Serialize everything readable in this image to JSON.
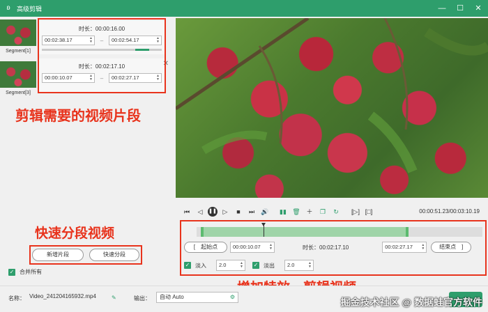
{
  "window": {
    "title": "高级剪辑",
    "app_icon": "frog-icon",
    "minimize": "—",
    "maximize": "☐",
    "close": "✕"
  },
  "thumbnails": [
    {
      "label": "Segment[1]"
    },
    {
      "label": "Segment[3]"
    }
  ],
  "segments": [
    {
      "duration": "时长：00:00:16.00",
      "start": "00:02:38.17",
      "end": "00:02:54.17"
    },
    {
      "duration": "时长：00:02:17.10",
      "start": "00:00:10.07",
      "end": "00:02:27.17"
    }
  ],
  "annotations": {
    "segments_note": "剪辑需要的视频片段",
    "split_note": "快速分段视频",
    "effects_note": "增加特效、剪辑视频"
  },
  "buttons": {
    "add_segment": "新增片段",
    "quick_split": "快速分段"
  },
  "merge_all": {
    "label": "合并所有",
    "checked": true
  },
  "player": {
    "time_readout": "00:00:51.23/00:03:10.19",
    "controls": [
      "step-back-icon",
      "prev-icon",
      "play-pause-icon",
      "next-icon",
      "stop-icon",
      "skip-end-icon",
      "volume-icon",
      "split-icon",
      "delete-icon",
      "add-icon",
      "copy-icon",
      "refresh-icon",
      "mark-in-icon",
      "mark-out-icon"
    ]
  },
  "timeline": {
    "start_btn": "[　起始点",
    "start_time": "00:00:10.07",
    "duration": "时长：00:02:17.10",
    "end_time": "00:02:27.17",
    "end_btn": "结束点　]",
    "fade_in_label": "淡入",
    "fade_in_value": "2.0",
    "fade_out_label": "淡出",
    "fade_out_value": "2.0"
  },
  "bottom": {
    "name_label": "名称：",
    "name_value": "Video_241204165932.mp4",
    "output_label": "输出：",
    "output_value": "自动 Auto",
    "watermark": "掘金技术社区 @ 数据蛙官方软件"
  },
  "colors": {
    "accent": "#2e9e6c",
    "annotation": "#e8331c"
  }
}
